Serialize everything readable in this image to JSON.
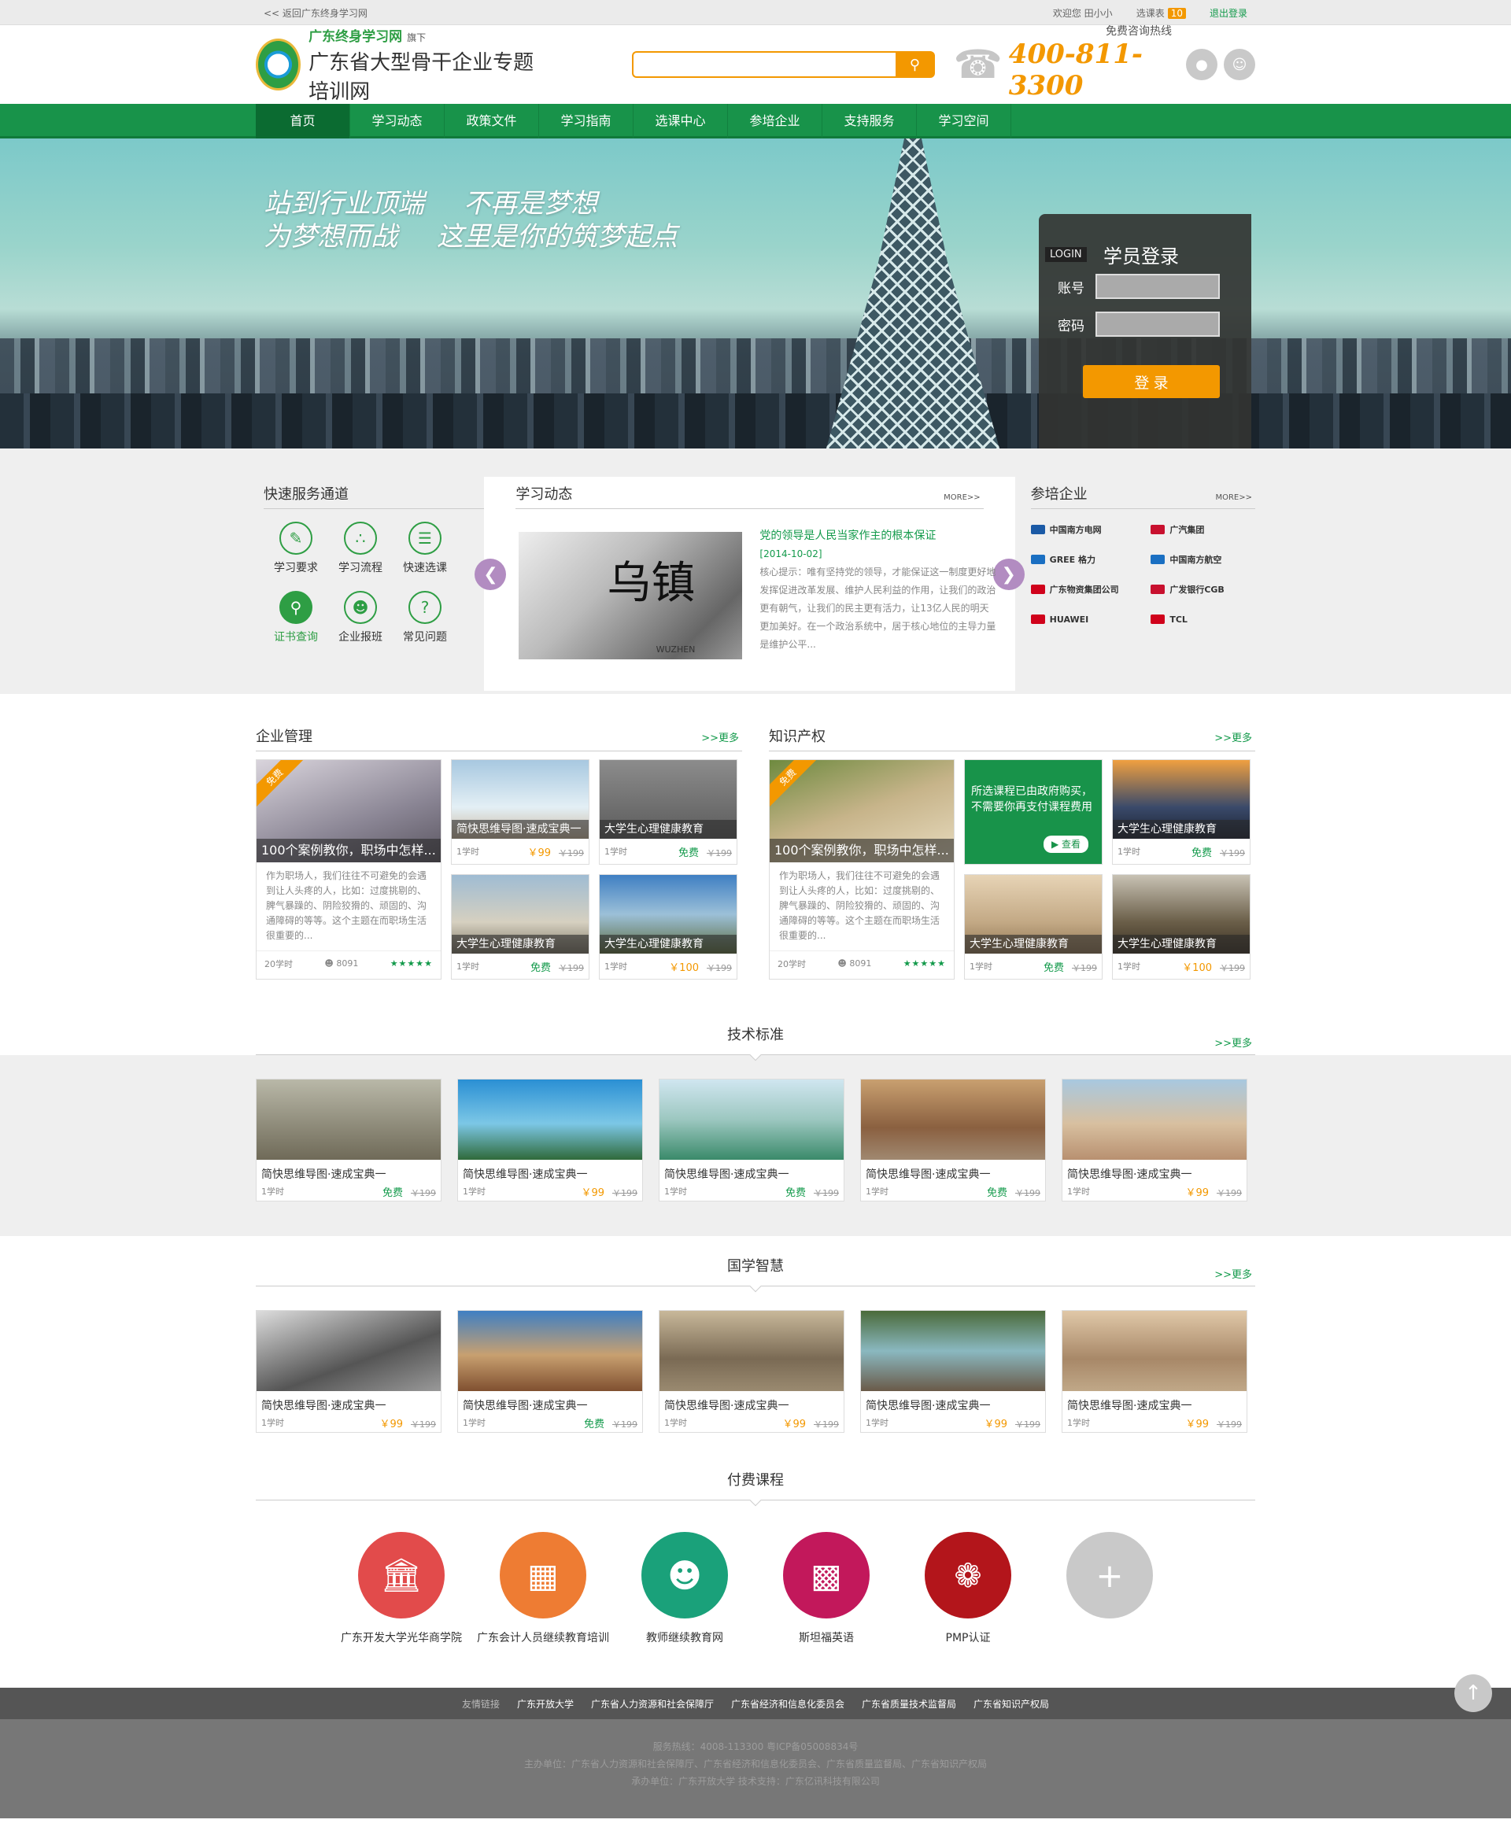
{
  "topbar": {
    "back": "<< 返回广东终身学习网",
    "welcome": "欢迎您 田小小",
    "cart_label": "选课表",
    "cart_count": "10",
    "logout": "退出登录"
  },
  "header": {
    "logo_line1": "广东终身学习网",
    "logo_sub": "旗下",
    "logo_line2": "广东省大型骨干企业专题培训网",
    "search_placeholder": "",
    "hotline_label": "免费咨询热线",
    "hotline": "400-811-3300"
  },
  "nav": [
    "首页",
    "学习动态",
    "政策文件",
    "学习指南",
    "选课中心",
    "参培企业",
    "支持服务",
    "学习空间"
  ],
  "banner": {
    "slogan1a": "站到行业顶端",
    "slogan1b": "不再是梦想",
    "slogan2a": "为梦想而战",
    "slogan2b": "这里是你的筑梦起点"
  },
  "login": {
    "tag": "LOGIN",
    "title": "学员登录",
    "account": "账号",
    "password": "密码",
    "submit": "登 录"
  },
  "quick": {
    "title": "快速服务通道",
    "items": [
      "学习要求",
      "学习流程",
      "快速选课",
      "证书查询",
      "企业报班",
      "常见问题"
    ]
  },
  "news": {
    "title": "学习动态",
    "more": "MORE>>",
    "item_title": "党的领导是人民当家作主的根本保证",
    "date": "[2014-10-02]",
    "body": "核心提示：唯有坚持党的领导，才能保证这一制度更好地发挥促进改革发展、维护人民利益的作用，让我们的政治更有朝气，让我们的民主更有活力，让13亿人民的明天更加美好。在一个政治系统中，居于核心地位的主导力量是维护公平...",
    "img_text": "乌镇",
    "img_sub": "WUZHEN"
  },
  "partners": {
    "title": "参培企业",
    "more": "MORE>>",
    "items": [
      "中国南方电网",
      "广汽集团",
      "GREE 格力",
      "中国南方航空",
      "广东物资集团公司",
      "广发银行CGB",
      "HUAWEI",
      "TCL"
    ],
    "colors": [
      "#1b5aa6",
      "#c8102e",
      "#1a6fc2",
      "#1a6fc2",
      "#d0021b",
      "#c8102e",
      "#d0021b",
      "#d0021b"
    ]
  },
  "sec1": {
    "title": "企业管理",
    "more": ">>更多"
  },
  "sec2": {
    "title": "知识产权",
    "more": ">>更多"
  },
  "big_card": {
    "ribbon": "免费",
    "caption": "100个案例教你，职场中怎样...",
    "desc": "作为职场人，我们往往不可避免的会遇到让人头疼的人，比如：过度挑剔的、脾气暴躁的、阴险狡猾的、顽固的、沟通障碍的等等。这个主题在而职场生活很重要的...",
    "hours": "20学时",
    "views": "8091",
    "stars": "★★★★★"
  },
  "cards_left": [
    {
      "cap": "简快思维导图·速成宝典一",
      "hours": "1学时",
      "price": "￥99",
      "old": "￥199"
    },
    {
      "cap": "大学生心理健康教育",
      "hours": "1学时",
      "price": "免费",
      "old": "￥199"
    },
    {
      "cap": "大学生心理健康教育",
      "hours": "1学时",
      "price": "免费",
      "old": "￥199"
    },
    {
      "cap": "大学生心理健康教育",
      "hours": "1学时",
      "price": "￥100",
      "old": "￥199"
    }
  ],
  "notice": {
    "text": "所选课程已由政府购买，不需要你再支付课程费用",
    "btn": "查看"
  },
  "cards_right": [
    {
      "cap": "大学生心理健康教育",
      "hours": "1学时",
      "price": "免费",
      "old": "￥199"
    },
    {
      "cap": "大学生心理健康教育",
      "hours": "1学时",
      "price": "免费",
      "old": "￥199"
    },
    {
      "cap": "大学生心理健康教育",
      "hours": "1学时",
      "price": "￥100",
      "old": "￥199"
    }
  ],
  "sec3": {
    "title": "技术标准",
    "more": ">>更多"
  },
  "tech": [
    {
      "title": "简快思维导图·速成宝典一",
      "hours": "1学时",
      "price": "免费",
      "old": "￥199"
    },
    {
      "title": "简快思维导图·速成宝典一",
      "hours": "1学时",
      "price": "￥99",
      "old": "￥199"
    },
    {
      "title": "简快思维导图·速成宝典一",
      "hours": "1学时",
      "price": "免费",
      "old": "￥199"
    },
    {
      "title": "简快思维导图·速成宝典一",
      "hours": "1学时",
      "price": "免费",
      "old": "￥199"
    },
    {
      "title": "简快思维导图·速成宝典一",
      "hours": "1学时",
      "price": "￥99",
      "old": "￥199"
    }
  ],
  "sec4": {
    "title": "国学智慧",
    "more": ">>更多"
  },
  "guoxue": [
    {
      "title": "简快思维导图·速成宝典一",
      "hours": "1学时",
      "price": "￥99",
      "old": "￥199"
    },
    {
      "title": "简快思维导图·速成宝典一",
      "hours": "1学时",
      "price": "免费",
      "old": "￥199"
    },
    {
      "title": "简快思维导图·速成宝典一",
      "hours": "1学时",
      "price": "￥99",
      "old": "￥199"
    },
    {
      "title": "简快思维导图·速成宝典一",
      "hours": "1学时",
      "price": "￥99",
      "old": "￥199"
    },
    {
      "title": "简快思维导图·速成宝典一",
      "hours": "1学时",
      "price": "￥99",
      "old": "￥199"
    }
  ],
  "sec5": {
    "title": "付费课程"
  },
  "paid": [
    {
      "label": "广东开发大学光华商学院",
      "color": "#e24b4b",
      "icon": "bank-icon"
    },
    {
      "label": "广东会计人员继续教育培训",
      "color": "#ee7c33",
      "icon": "calculator-icon"
    },
    {
      "label": "教师继续教育网",
      "color": "#1aa17a",
      "icon": "teacher-icon"
    },
    {
      "label": "斯坦福英语",
      "color": "#c2185b",
      "icon": "binary-icon"
    },
    {
      "label": "PMP认证",
      "color": "#b3151b",
      "icon": "seal-icon"
    },
    {
      "label": "",
      "color": "#c9c9c9",
      "icon": "plus-icon"
    }
  ],
  "flinks": {
    "label": "友情链接",
    "items": [
      "广东开放大学",
      "广东省人力资源和社会保障厅",
      "广东省经济和信息化委员会",
      "广东省质量技术监督局",
      "广东省知识产权局"
    ]
  },
  "footer": {
    "line1": "服务热线：4008-113300 粤ICP备05008834号",
    "line2": "主办单位：广东省人力资源和社会保障厅、广东省经济和信息化委员会、广东省质量监督局、广东省知识产权局",
    "line3": "承办单位：广东开放大学    技术支持：广东亿讯科技有限公司"
  }
}
